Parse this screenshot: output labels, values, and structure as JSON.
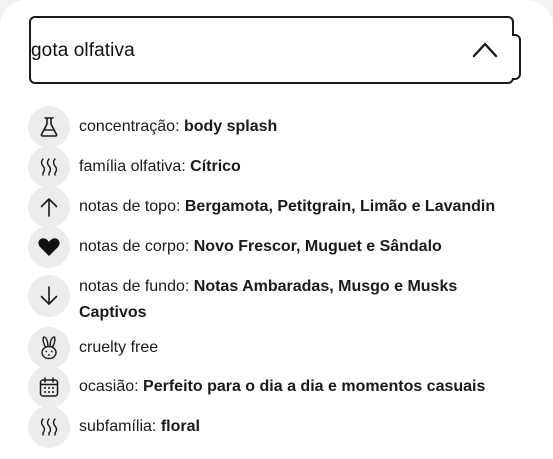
{
  "accordion": {
    "title": "gota olfativa",
    "expanded": true
  },
  "attributes": [
    {
      "icon": "flask-icon",
      "label": "concentração",
      "separator": ": ",
      "value": "body splash"
    },
    {
      "icon": "scent-waves-icon",
      "label": "família olfativa",
      "separator": ": ",
      "value": "Cítrico"
    },
    {
      "icon": "arrow-up-icon",
      "label": "notas de topo",
      "separator": ": ",
      "value": "Bergamota, Petitgrain, Limão e Lavandin"
    },
    {
      "icon": "heart-icon",
      "label": "notas de corpo",
      "separator": ": ",
      "value": "Novo Frescor, Muguet e Sândalo"
    },
    {
      "icon": "arrow-down-icon",
      "label": "notas de fundo",
      "separator": ": ",
      "value": "Notas Ambaradas, Musgo e Musks Captivos"
    },
    {
      "icon": "bunny-icon",
      "label": "cruelty free",
      "separator": "",
      "value": ""
    },
    {
      "icon": "calendar-icon",
      "label": "ocasião",
      "separator": ": ",
      "value": "Perfeito para o dia a dia e momentos casuais"
    },
    {
      "icon": "scent-waves-icon",
      "label": "subfamília",
      "separator": ": ",
      "value": "floral"
    }
  ]
}
